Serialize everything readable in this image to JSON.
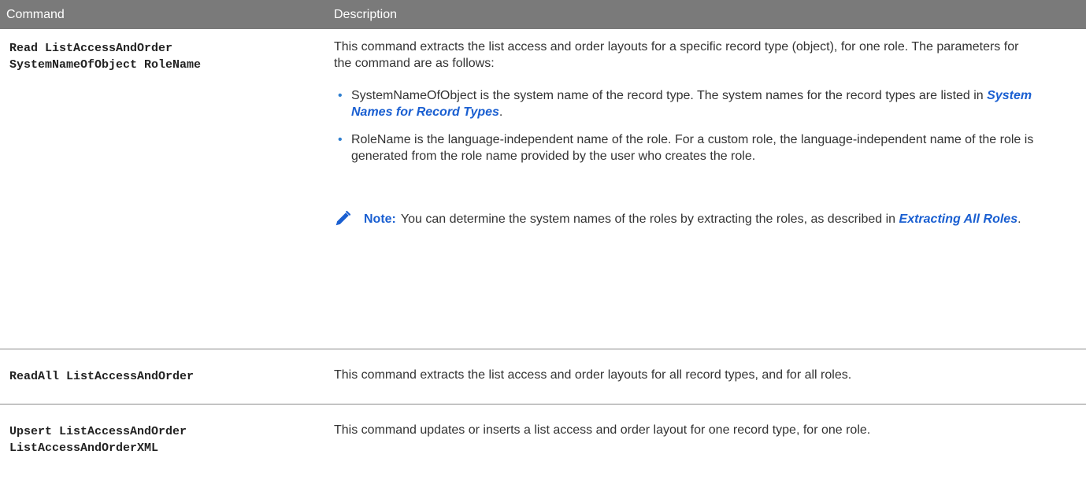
{
  "header": {
    "command_label": "Command",
    "description_label": "Description"
  },
  "rows": [
    {
      "command_line1": "Read ListAccessAndOrder",
      "command_line2": "SystemNameOfObject RoleName",
      "description": "This command extracts the list access and order layouts for a specific record type (object), for one role. The parameters for the command are as follows:",
      "params": [
        {
          "text": "SystemNameOfObject is the system name of the record type. The system names for the record types are listed in ",
          "link": "System Names for Record Types",
          "after": "."
        },
        {
          "text": "RoleName is the language-independent name of the role. For a custom role, the language-independent name of the role is generated from the role name provided by the user who creates the role."
        }
      ],
      "note": {
        "icon": "pencil-icon",
        "label": "Note:",
        "text": "You can determine the system names of the roles by extracting the roles, as described in ",
        "link": "Extracting All Roles",
        "after": "."
      }
    },
    {
      "command_line1": "ReadAll ListAccessAndOrder",
      "description": "This command extracts the list access and order layouts for all record types, and for all roles."
    },
    {
      "command_line1": "Upsert ListAccessAndOrder",
      "command_line2": "ListAccessAndOrderXML",
      "description": "This command updates or inserts a list access and order layout for one record type, for one role."
    }
  ],
  "colors": {
    "header_bg": "#7a7a7a",
    "link": "#1a5fd1",
    "bullet": "#2f7fd0"
  }
}
